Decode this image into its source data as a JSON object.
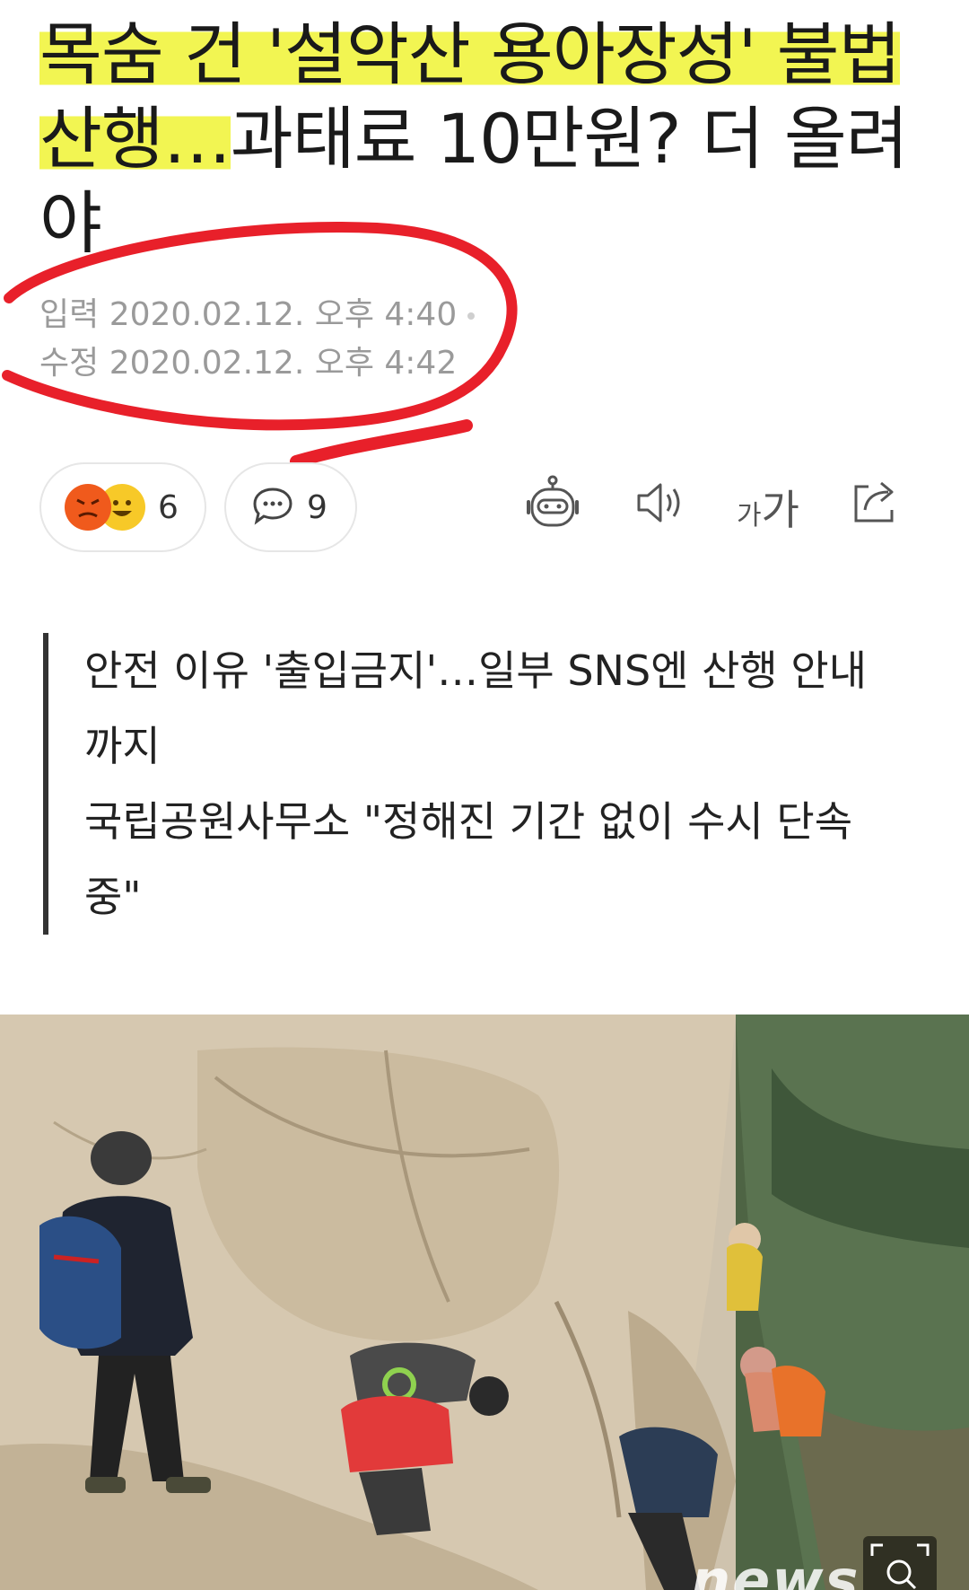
{
  "headline": {
    "highlighted": "목숨 건 '설악산 용아장성' 불법 산행…",
    "rest": "과태료 10만원? 더 올려야"
  },
  "meta": {
    "input_label": "입력",
    "input_datetime": "2020.02.12. 오후 4:40",
    "modified_label": "수정",
    "modified_datetime": "2020.02.12. 오후 4:42"
  },
  "actions": {
    "reaction_count": "6",
    "comment_count": "9",
    "font_size_small": "가",
    "font_size_big": "가",
    "icons": [
      "angry-emoji-icon",
      "happy-emoji-icon",
      "comment-icon",
      "robot-summary-icon",
      "speaker-icon",
      "font-size-icon",
      "share-icon"
    ]
  },
  "summary": {
    "line1": "안전 이유 '출입금지'…일부 SNS엔 산행 안내까지",
    "line2": "국립공원사무소 \"정해진 기간 없이 수시 단속 중\""
  },
  "photo": {
    "watermark": "news"
  },
  "colors": {
    "highlight": "#f2f552",
    "circle_annotation": "#e8202a",
    "meta_text": "#9a9a9a",
    "angry_emoji": "#f05a1c",
    "happy_emoji": "#f7c928"
  }
}
